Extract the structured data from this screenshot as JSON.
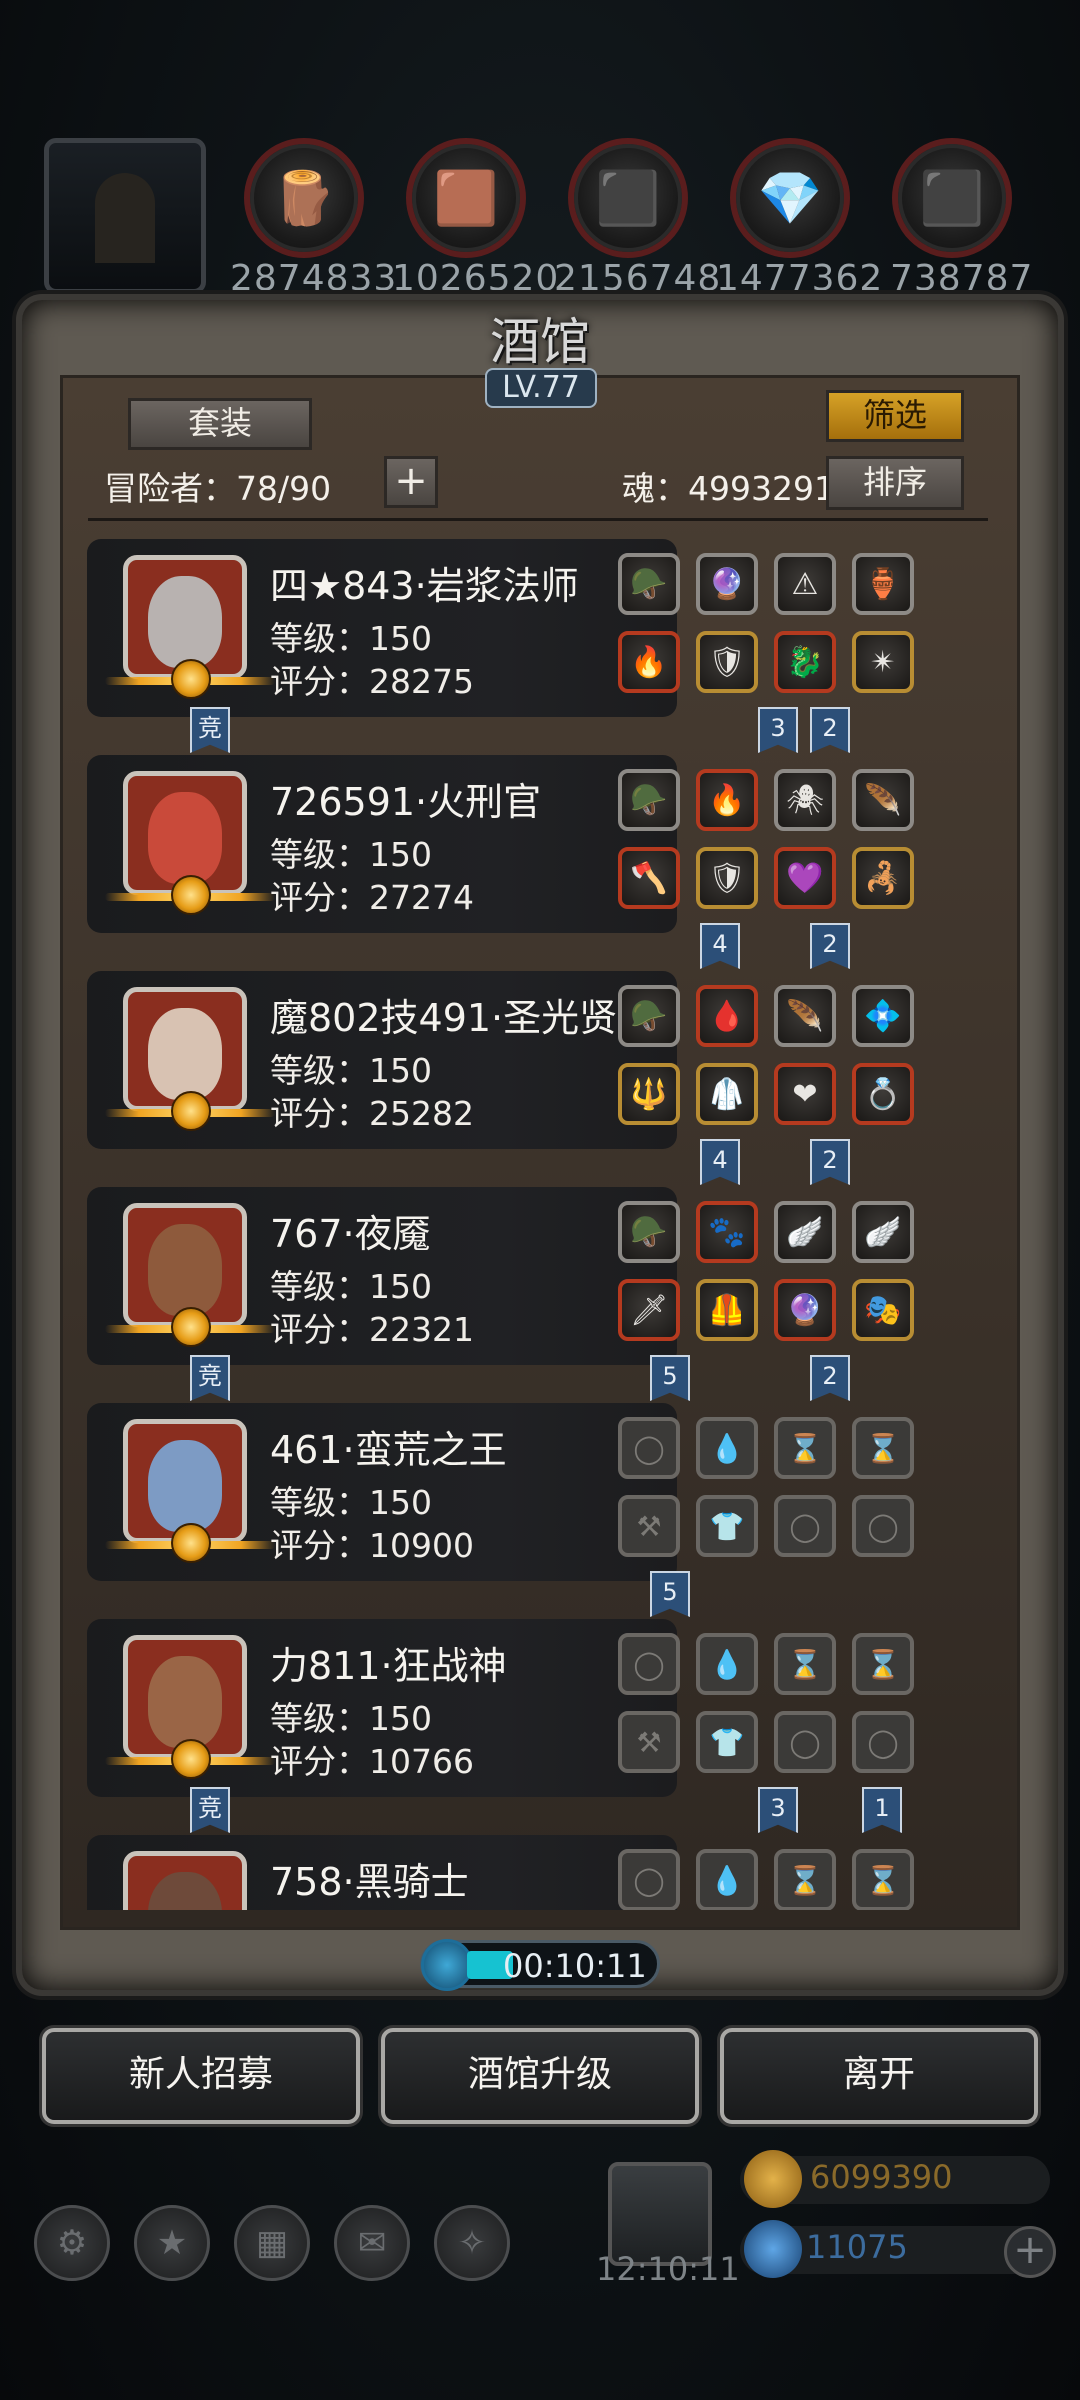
{
  "resources": {
    "values": [
      "2874833",
      "1026520",
      "2156748",
      "1477362",
      "738787"
    ],
    "icons": [
      "wood-log-icon",
      "plank-icon",
      "iron-ingot-icon",
      "crystal-icon",
      "stone-icon"
    ]
  },
  "tavern": {
    "title": "酒馆",
    "level": "LV.77",
    "set_button": "套装",
    "filter_button": "筛选",
    "sort_button": "排序",
    "adventurers_label": "冒险者：78/90",
    "add_button": "+",
    "soul_label": "魂：4993291"
  },
  "heroes": [
    {
      "name": "四★843·岩浆法师",
      "level": "等级：150",
      "score": "评分：28275",
      "face": "#b8b2b0",
      "badges": [
        {
          "text": "竞"
        },
        {
          "text": "3"
        },
        {
          "text": "2"
        }
      ]
    },
    {
      "name": "726591·火刑官",
      "level": "等级：150",
      "score": "评分：27274",
      "face": "#c94a3a",
      "badges": [
        {
          "text": "4"
        },
        {
          "text": "2"
        }
      ]
    },
    {
      "name": "魔802技491·圣光贤者",
      "level": "等级：150",
      "score": "评分：25282",
      "face": "#d8c2b2",
      "badges": [
        {
          "text": "4"
        },
        {
          "text": "2"
        }
      ]
    },
    {
      "name": "767·夜魇",
      "level": "等级：150",
      "score": "评分：22321",
      "face": "#8e5a3c",
      "badges": [
        {
          "text": "竞"
        },
        {
          "text": "5"
        },
        {
          "text": "2"
        }
      ]
    },
    {
      "name": "461·蛮荒之王",
      "level": "等级：150",
      "score": "评分：10900",
      "face": "#7d9bc4",
      "badges": [
        {
          "text": "5"
        }
      ]
    },
    {
      "name": "力811·狂战神",
      "level": "等级：150",
      "score": "评分：10766",
      "face": "#9a6546",
      "badges": [
        {
          "text": "竞"
        },
        {
          "text": "3"
        },
        {
          "text": "1"
        }
      ]
    },
    {
      "name": "758·黑骑士",
      "level": "",
      "score": "",
      "face": "#6e4a3a",
      "badges": []
    }
  ],
  "timer": "00:10:11",
  "bottom_buttons": {
    "recruit": "新人招募",
    "upgrade": "酒馆升级",
    "leave": "离开"
  },
  "footer": {
    "clock": "12:10:11",
    "gold": "6099390",
    "gems": "11075"
  },
  "colors": {
    "accent_gold": "#d6a227",
    "frame": "#5f5a52",
    "badge_blue": "#2c4f78"
  }
}
